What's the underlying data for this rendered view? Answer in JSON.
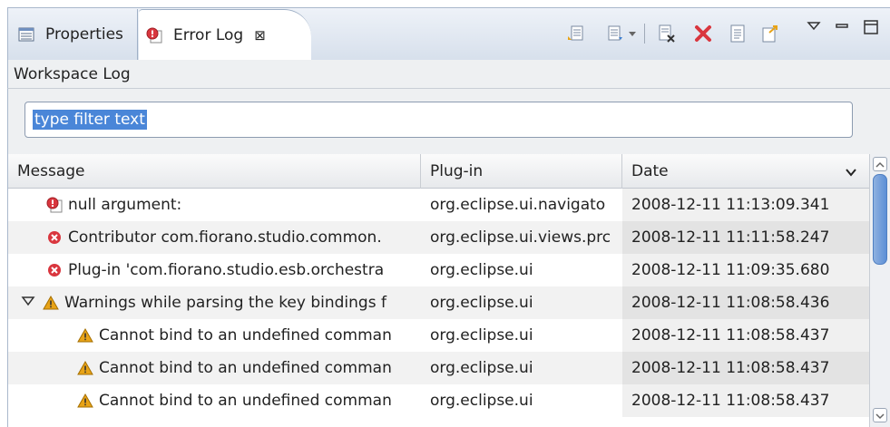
{
  "tabs": [
    {
      "label": "Properties",
      "icon": "properties-icon",
      "active": false
    },
    {
      "label": "Error Log",
      "icon": "error-log-icon",
      "active": true
    }
  ],
  "view": {
    "title": "Workspace Log",
    "filter_value": "type filter text"
  },
  "table": {
    "columns": [
      "Message",
      "Plug-in",
      "Date"
    ],
    "rows": [
      {
        "icon": "error-log-icon",
        "indent": 1,
        "message": "null argument:",
        "plugin": "org.eclipse.ui.navigato",
        "date": "2008-12-11 11:13:09.341"
      },
      {
        "icon": "error-icon",
        "indent": 1,
        "message": "Contributor com.fiorano.studio.common.",
        "plugin": "org.eclipse.ui.views.prc",
        "date": "2008-12-11 11:11:58.247"
      },
      {
        "icon": "error-icon",
        "indent": 1,
        "message": "Plug-in 'com.fiorano.studio.esb.orchestra",
        "plugin": "org.eclipse.ui",
        "date": "2008-12-11 11:09:35.680"
      },
      {
        "icon": "warning-icon",
        "indent": 0,
        "expanded": true,
        "message": "Warnings while parsing the key bindings f",
        "plugin": "org.eclipse.ui",
        "date": "2008-12-11 11:08:58.436"
      },
      {
        "icon": "warning-icon",
        "indent": 2,
        "message": "Cannot bind to an undefined comman",
        "plugin": "org.eclipse.ui",
        "date": "2008-12-11 11:08:58.437"
      },
      {
        "icon": "warning-icon",
        "indent": 2,
        "message": "Cannot bind to an undefined comman",
        "plugin": "org.eclipse.ui",
        "date": "2008-12-11 11:08:58.437"
      },
      {
        "icon": "warning-icon",
        "indent": 2,
        "message": "Cannot bind to an undefined comman",
        "plugin": "org.eclipse.ui",
        "date": "2008-12-11 11:08:58.437"
      }
    ]
  },
  "colors": {
    "error": "#d9363e",
    "warning": "#e8a317",
    "selection": "#4a86d8"
  }
}
